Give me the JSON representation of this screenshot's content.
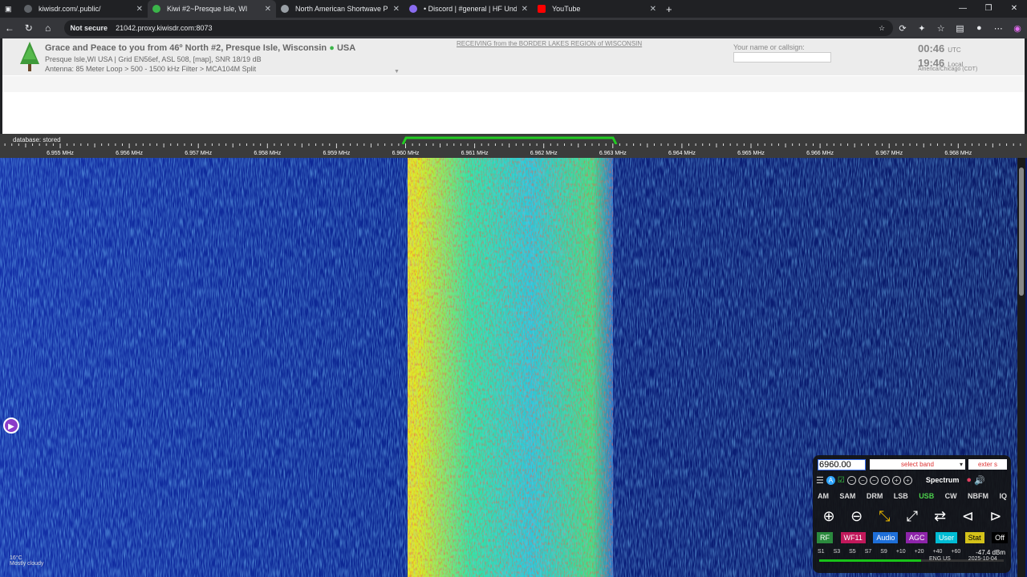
{
  "browser": {
    "tabs": [
      {
        "title": "kiwisdr.com/.public/",
        "color": "#5f6368"
      },
      {
        "title": "Kiwi #2~Presque Isle, WI",
        "color": "#3bb54a",
        "active": true
      },
      {
        "title": "North American Shortwave Pirate",
        "color": "#9aa0a6"
      },
      {
        "title": "• Discord | #general | HF Undergr",
        "color": "#8a6cf0"
      },
      {
        "title": "YouTube",
        "color": "#ff0000"
      }
    ],
    "new_tab": "+",
    "not_secure": "Not secure",
    "url": "21042.proxy.kiwisdr.com:8073"
  },
  "kiwi": {
    "title": "Grace and Peace to you from 46º North #2, Presque Isle, Wisconsin",
    "country": "USA",
    "location_line": "Presque Isle,WI USA | Grid EN56ef, ASL 508, [map], SNR 18/19 dB",
    "antenna_line": "Antenna: 85 Meter Loop > 500 - 1500 kHz Filter > MCA104M Split",
    "receiving": "RECEIVING from the BORDER LAKES REGION of WISCONSIN",
    "callsign_label": "Your name or callsign:",
    "utc_time": "00:46",
    "utc_label": "UTC",
    "local_time": "19:46",
    "local_label": "Local",
    "timezone": "America/Chicago (CDT)",
    "db_status": "database: stored"
  },
  "scale": {
    "labels": [
      "6.955 MHz",
      "6.956 MHz",
      "6.957 MHz",
      "6.958 MHz",
      "6.959 MHz",
      "6.960 MHz",
      "6.961 MHz",
      "6.962 MHz",
      "6.963 MHz",
      "6.964 MHz",
      "6.965 MHz",
      "6.966 MHz",
      "6.967 MHz",
      "6.968 MHz"
    ]
  },
  "controls": {
    "frequency": "6960.00",
    "band_select": "select band",
    "ext_select": "exter s",
    "spectrum_label": "Spectrum",
    "modes": [
      "AM",
      "SAM",
      "DRM",
      "LSB",
      "USB",
      "CW",
      "NBFM",
      "IQ"
    ],
    "active_mode": "USB",
    "tabs": [
      {
        "label": "RF",
        "bg": "#2b8a3e"
      },
      {
        "label": "WF11",
        "bg": "#c2185b"
      },
      {
        "label": "Audio",
        "bg": "#1e6fd9"
      },
      {
        "label": "AGC",
        "bg": "#8e24aa"
      },
      {
        "label": "User",
        "bg": "#00bcd4"
      },
      {
        "label": "Stat",
        "bg": "#d4c21a"
      },
      {
        "label": "Off",
        "bg": "#000000"
      }
    ],
    "smeter_labels": [
      "S1",
      "S3",
      "S5",
      "S7",
      "S9",
      "+10",
      "+20",
      "+40",
      "+60"
    ],
    "smeter_value": "-47.4",
    "smeter_unit": "dBm"
  },
  "taskbar": {
    "temperature": "16°C",
    "weather": "Mostly cloudy",
    "lang": "ENG US",
    "date": "2025-10-04"
  }
}
